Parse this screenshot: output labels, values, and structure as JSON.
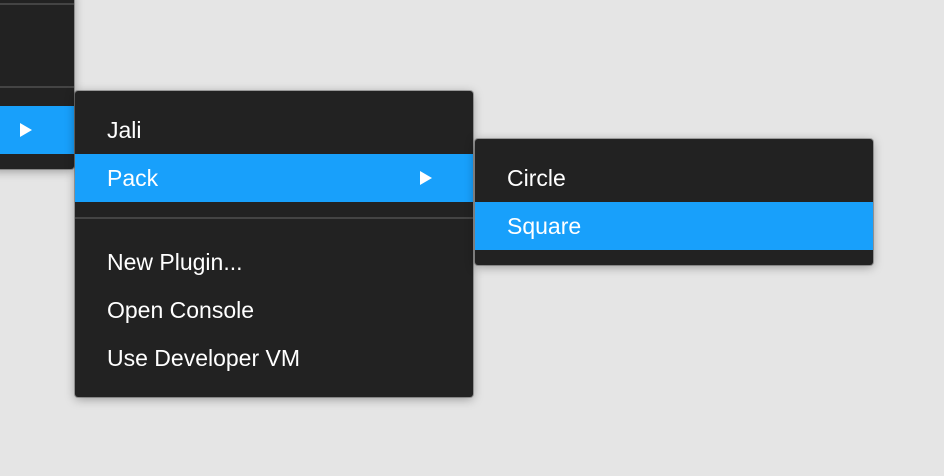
{
  "parent_menu": {
    "active_item_label": ""
  },
  "plugins_menu": {
    "items": [
      {
        "label": "Jali"
      },
      {
        "label": "Pack"
      },
      {
        "label": "New Plugin..."
      },
      {
        "label": "Open Console"
      },
      {
        "label": "Use Developer VM"
      }
    ]
  },
  "pack_submenu": {
    "items": [
      {
        "label": "Circle"
      },
      {
        "label": "Square"
      }
    ]
  },
  "colors": {
    "menu_background": "#222222",
    "highlight": "#18a0fb",
    "separator": "#444444",
    "desktop": "#e5e5e5",
    "text": "#ffffff"
  },
  "icons": {
    "submenu_arrow": "triangle-right-icon"
  }
}
